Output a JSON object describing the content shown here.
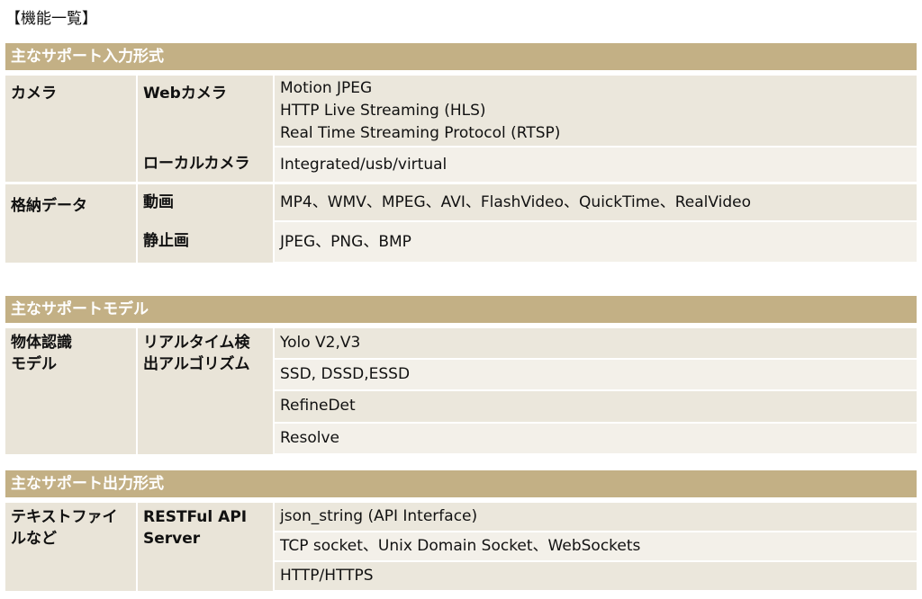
{
  "page_title": "【機能一覧】",
  "sections": [
    {
      "title": "主なサポート入力形式",
      "groups": [
        {
          "category": "カメラ",
          "items": [
            {
              "sub": "Webカメラ",
              "values": [
                "Motion JPEG",
                "HTTP Live Streaming (HLS)",
                "Real Time Streaming Protocol (RTSP)"
              ]
            },
            {
              "sub": "ローカルカメラ",
              "values": [
                "Integrated/usb/virtual"
              ]
            }
          ]
        },
        {
          "category": "格納データ",
          "items": [
            {
              "sub": "動画",
              "values": [
                "MP4、WMV、MPEG、AVI、FlashVideo、QuickTime、RealVideo"
              ]
            },
            {
              "sub": "静止画",
              "values": [
                "JPEG、PNG、BMP"
              ]
            }
          ]
        }
      ]
    },
    {
      "title": "主なサポートモデル",
      "category": "物体認識\nモデル",
      "sub": "リアルタイム検\n出アルゴリズム",
      "values": [
        "Yolo V2,V3",
        "SSD, DSSD,ESSD",
        "RefineDet",
        "Resolve"
      ]
    },
    {
      "title": "主なサポート出力形式",
      "category": "テキストファイ\nルなど",
      "sub": "RESTFul API\nServer",
      "values": [
        "json_string (API Interface)",
        "TCP socket、Unix Domain Socket、WebSockets",
        "HTTP/HTTPS"
      ]
    }
  ]
}
